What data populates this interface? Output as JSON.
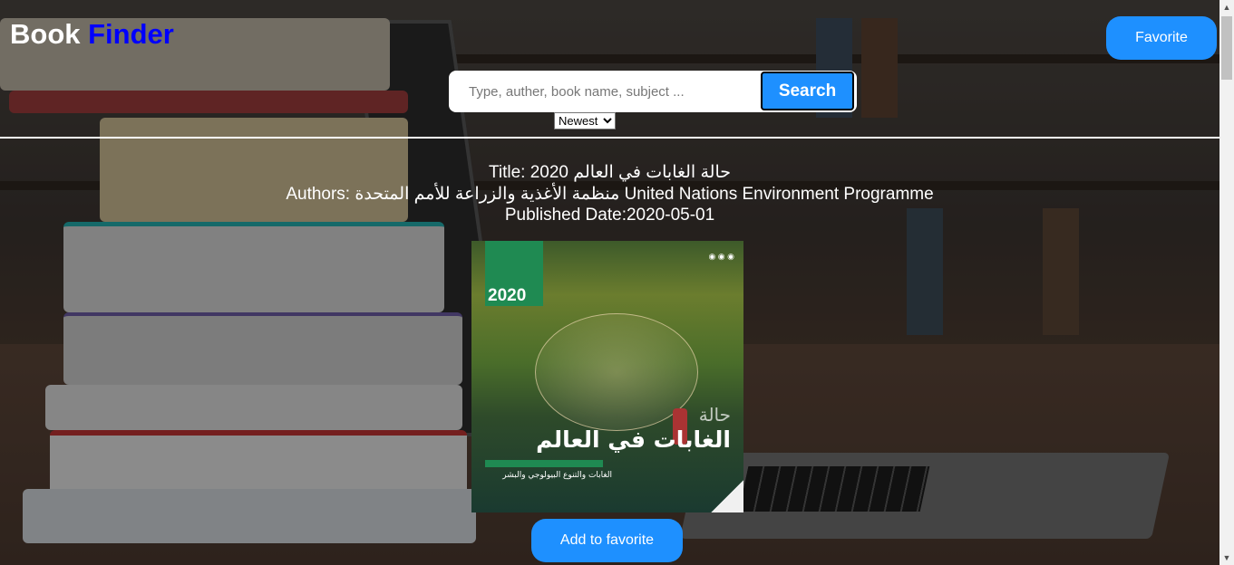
{
  "header": {
    "logo_part1": "Book",
    "logo_part2": "Finder",
    "favorite_label": "Favorite"
  },
  "search": {
    "placeholder": "Type, auther, book name, subject ...",
    "value": "",
    "button_label": "Search",
    "sort_selected": "Newest"
  },
  "result": {
    "title_line": "Title: حالة الغابات في العالم 2020",
    "authors_line": "Authors: منظمة الأغذية والزراعة للأمم المتحدة United Nations Environment Programme",
    "date_line": "Published Date:2020-05-01",
    "cover": {
      "year": "2020",
      "title_light": "حالة",
      "title_main": "الغابات في العالم",
      "subtitle": "الغابات والتنوع البيولوجي والبشر"
    },
    "add_favorite_label": "Add to favorite"
  },
  "colors": {
    "accent": "#1e90ff",
    "logo_accent": "#0000ff"
  }
}
